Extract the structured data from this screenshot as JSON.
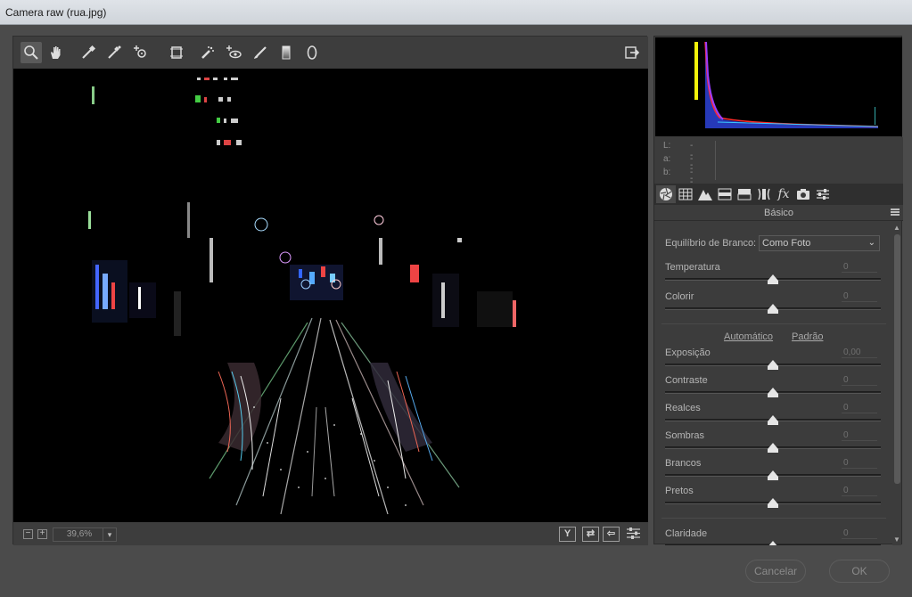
{
  "window": {
    "title": "Camera raw (rua.jpg)"
  },
  "toolbar": {
    "tools": [
      "zoom-tool",
      "hand-tool",
      "white-balance-tool",
      "color-sampler-tool",
      "targeted-adjustment-tool",
      "transform-tool",
      "spot-removal-tool",
      "red-eye-removal-tool",
      "adjustment-brush-tool",
      "graduated-filter-tool",
      "radial-filter-tool"
    ],
    "fullscreen_icon": "open-preferences-icon"
  },
  "status": {
    "zoom_out": "−",
    "zoom_in": "+",
    "zoom_value": "39,6%",
    "view_buttons": [
      "Y",
      "⇄",
      "⇦",
      "⚙"
    ]
  },
  "lab": {
    "labels": [
      "L:",
      "a:",
      "b:"
    ],
    "values": [
      "---",
      "---",
      "---"
    ]
  },
  "panel": {
    "section_title": "Básico",
    "white_balance_label": "Equilíbrio de Branco:",
    "white_balance_value": "Como Foto",
    "auto_link": "Automático",
    "default_link": "Padrão",
    "sliders": {
      "temperatura": {
        "label": "Temperatura",
        "value": "0",
        "level": 0.5
      },
      "colorir": {
        "label": "Colorir",
        "value": "0",
        "level": 0.5
      },
      "exposicao": {
        "label": "Exposição",
        "value": "0,00",
        "level": 0.5
      },
      "contraste": {
        "label": "Contraste",
        "value": "0",
        "level": 0.5
      },
      "realces": {
        "label": "Realces",
        "value": "0",
        "level": 0.5
      },
      "sombras": {
        "label": "Sombras",
        "value": "0",
        "level": 0.5
      },
      "brancos": {
        "label": "Brancos",
        "value": "0",
        "level": 0.5
      },
      "pretos": {
        "label": "Pretos",
        "value": "0",
        "level": 0.5
      },
      "claridade": {
        "label": "Claridade",
        "value": "0",
        "level": 0.5
      }
    }
  },
  "buttons": {
    "cancel": "Cancelar",
    "ok": "OK"
  },
  "colors": {
    "panel_bg": "#3c3c3c",
    "preview_bg": "#000000",
    "histogram_red": "#ff2a2a",
    "histogram_yellow": "#f2f20a",
    "histogram_blue": "#3a5bff"
  }
}
